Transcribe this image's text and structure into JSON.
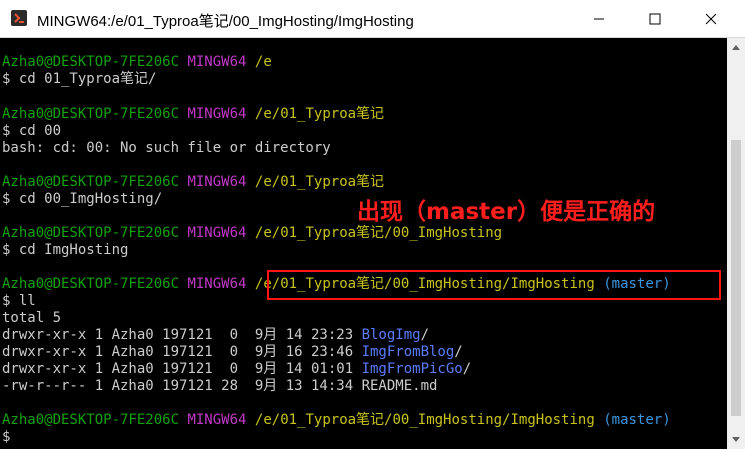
{
  "window": {
    "title": "MINGW64:/e/01_Typroa笔记/00_ImgHosting/ImgHosting",
    "icon": "git-bash-icon",
    "controls": [
      "minimize-icon",
      "maximize-icon",
      "close-icon"
    ]
  },
  "colors": {
    "user_host": "#13a10e",
    "shell": "#c238c8",
    "path": "#c7c31a",
    "text": "#cccccc",
    "branch": "#3a96dd",
    "directory": "#5c7cff",
    "annotation": "#ff1e1e"
  },
  "terminal": {
    "blocks": [
      {
        "user": "Azha0@DESKTOP-7FE206C",
        "shell": "MINGW64",
        "path": "/e",
        "command": "$ cd 01_Typroa笔记/"
      },
      {
        "user": "Azha0@DESKTOP-7FE206C",
        "shell": "MINGW64",
        "path": "/e/01_Typroa笔记",
        "command": "$ cd 00",
        "output": "bash: cd: 00: No such file or directory"
      },
      {
        "user": "Azha0@DESKTOP-7FE206C",
        "shell": "MINGW64",
        "path": "/e/01_Typroa笔记",
        "command": "$ cd 00_ImgHosting/"
      },
      {
        "user": "Azha0@DESKTOP-7FE206C",
        "shell": "MINGW64",
        "path": "/e/01_Typroa笔记/00_ImgHosting",
        "command": "$ cd ImgHosting"
      },
      {
        "user": "Azha0@DESKTOP-7FE206C",
        "shell": "MINGW64",
        "path": "/e/01_Typroa笔记/00_ImgHosting/ImgHosting",
        "branch": "(master)",
        "command": "$ ll"
      },
      {
        "user": "Azha0@DESKTOP-7FE206C",
        "shell": "MINGW64",
        "path": "/e/01_Typroa笔记/00_ImgHosting/ImgHosting",
        "branch": "(master)",
        "command": "$"
      }
    ],
    "listing": {
      "total": "total 5",
      "rows": [
        {
          "meta": "drwxr-xr-x 1 Azha0 197121  0  9月 14 23:23 ",
          "name": "BlogImg",
          "suffix": "/"
        },
        {
          "meta": "drwxr-xr-x 1 Azha0 197121  0  9月 16 23:46 ",
          "name": "ImgFromBlog",
          "suffix": "/"
        },
        {
          "meta": "drwxr-xr-x 1 Azha0 197121  0  9月 14 01:01 ",
          "name": "ImgFromPicGo",
          "suffix": "/"
        },
        {
          "meta": "-rw-r--r-- 1 Azha0 197121 28  9月 13 14:34 ",
          "name": "README.md",
          "suffix": ""
        }
      ]
    }
  },
  "annotation": {
    "text": "出现（master）便是正确的"
  }
}
